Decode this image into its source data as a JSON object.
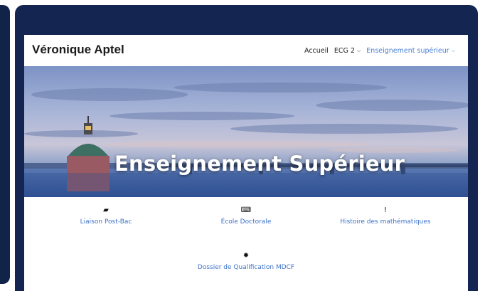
{
  "site": {
    "brand": "Véronique Aptel",
    "nav": [
      {
        "label": "Accueil",
        "has_dropdown": false,
        "active": false
      },
      {
        "label": "ECG 2",
        "has_dropdown": true,
        "active": false
      },
      {
        "label": "Enseignement supérieur",
        "has_dropdown": true,
        "active": true
      }
    ],
    "accent_color": "#4a7fd6"
  },
  "hero": {
    "title": "Enseignement Supérieur"
  },
  "links": [
    {
      "icon": "book-icon",
      "glyph": "▰",
      "label": "Liaison Post-Bac"
    },
    {
      "icon": "keyboard-icon",
      "glyph": "⌨",
      "label": "École Doctorale"
    },
    {
      "icon": "exclamation-icon",
      "glyph": "!",
      "label": "Histoire des mathématiques"
    },
    {
      "icon": "certificate-icon",
      "glyph": "✹",
      "label": "Dossier de Qualification MDCF"
    }
  ]
}
